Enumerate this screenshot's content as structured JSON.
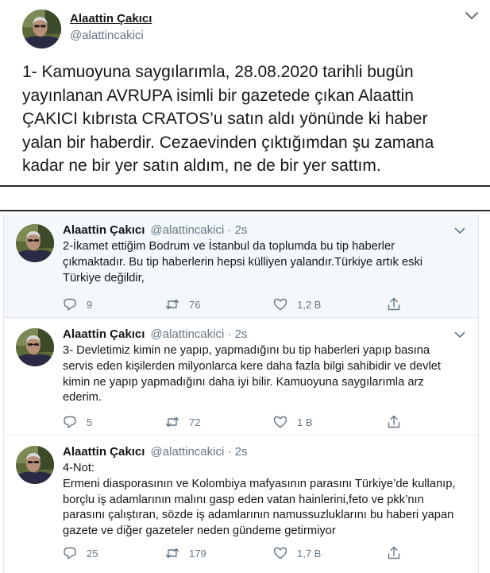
{
  "main_tweet": {
    "author_name": "Alaattin Çakıcı",
    "author_handle": "@alattincakici",
    "text_lines": [
      "1- Kamuoyuna saygılarımla, 28.08.2020 tarihli bugün",
      "yayınlanan AVRUPA isimli bir gazetede çıkan Alaattin",
      "ÇAKICI kıbrısta CRATOS’u satın aldı yönünde ki haber",
      "yalan bir haberdir. Cezaevinden çıktığımdan şu zamana",
      "kadar ne bir yer satın aldım, ne de bir yer sattım."
    ]
  },
  "thread": [
    {
      "author_name": "Alaattin Çakıcı",
      "author_handle": "@alattincakici",
      "time": "· 2s",
      "text_lines": [
        "2-İkamet ettiğim Bodrum ve İstanbul da toplumda bu tip haberler",
        "çıkmaktadır. Bu tip haberlerin hepsi külliyen yalandır.Türkiye artık eski",
        "Türkiye değildir,"
      ],
      "replies": "9",
      "retweets": "76",
      "likes": "1,2 B"
    },
    {
      "author_name": "Alaattin Çakıcı",
      "author_handle": "@alattincakici",
      "time": "· 2s",
      "text_lines": [
        "3- Devletimiz kimin ne yapıp, yapmadığını bu tip haberleri yapıp basına",
        "servis eden kişilerden milyonlarca kere daha fazla bilgi sahibidir ve devlet",
        "kimin ne yapıp yapmadığını daha iyi bilir. Kamuoyuna saygılarımla arz",
        "ederim."
      ],
      "replies": "5",
      "retweets": "72",
      "likes": "1 B"
    },
    {
      "author_name": "Alaattin Çakıcı",
      "author_handle": "@alattincakici",
      "time": "· 2s",
      "text_lines": [
        "4-Not:",
        "Ermeni diasporasının ve Kolombiya mafyasının parasını Türkiye’de kullanıp,",
        "borçlu iş adamlarının malını gasp eden vatan hainlerini,feto ve pkk’nın",
        "parasını çalıştıran, sözde iş adamlarının namussuzluklarını bu haberi yapan",
        "gazete ve diğer gazeteler neden gündeme getirmiyor"
      ],
      "replies": "25",
      "retweets": "179",
      "likes": "1,7 B"
    }
  ],
  "icons": {
    "more": "chevron-down-icon",
    "reply": "reply-icon",
    "retweet": "retweet-icon",
    "like": "heart-icon",
    "share": "share-icon"
  },
  "colors": {
    "text": "#14171a",
    "muted": "#657786",
    "border": "#e1e8ed",
    "highlight_bg": "#f5f8fa"
  }
}
